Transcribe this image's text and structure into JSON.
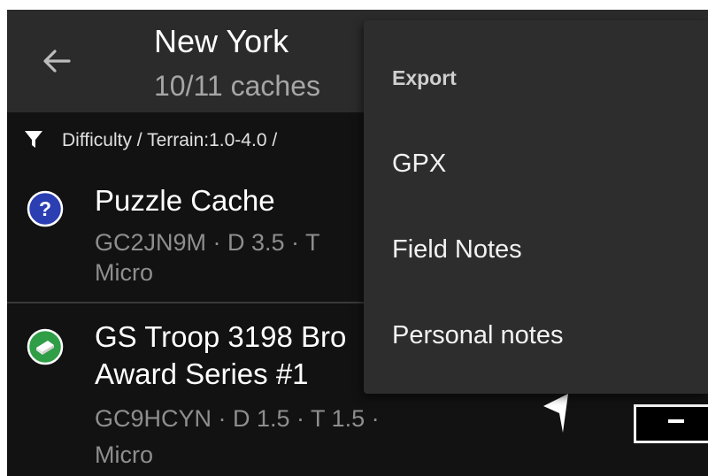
{
  "appbar": {
    "title": "New York",
    "subtitle": "10/11 caches"
  },
  "filter": {
    "text": "Difficulty / Terrain:1.0-4.0 /"
  },
  "caches": [
    {
      "name": "Puzzle Cache",
      "meta": "GC2JN9M · D 3.5 · T",
      "size": "Micro",
      "icon": "puzzle-cache-icon",
      "icon_color": "#2b3fb3"
    },
    {
      "name_line1": "GS Troop 3198 Bro",
      "name_line2": "Award Series #1",
      "meta": "GC9HCYN · D 1.5 · T 1.5 ·",
      "size": "Micro",
      "icon": "traditional-cache-icon",
      "icon_color": "#2f9e46"
    }
  ],
  "menu": {
    "header": "Export",
    "items": [
      "GPX",
      "Field Notes",
      "Personal notes"
    ]
  },
  "colors": {
    "appbar": "#2b2b2b",
    "background": "#121212",
    "menu": "#2d2d2d"
  }
}
